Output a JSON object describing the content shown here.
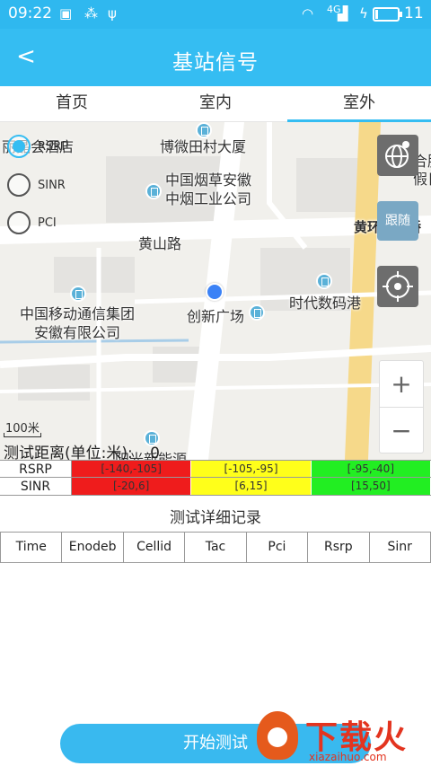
{
  "status_bar": {
    "time": "09:22",
    "network": "4G",
    "battery": "11",
    "battery_level": 0.11
  },
  "title_bar": {
    "back": "<",
    "title": "基站信号"
  },
  "tabs": [
    {
      "label": "首页"
    },
    {
      "label": "室内"
    },
    {
      "label": "室外"
    }
  ],
  "map": {
    "labels": {
      "hotel": "丽晶会酒店",
      "building1": "博微田村大厦",
      "tobacco": "中国烟草安徽\n中烟工业公司",
      "road": "黄山路",
      "china_mobile": "中国移动通信集团\n安徽有限公司",
      "plaza": "创新广场",
      "digital": "时代数码港",
      "edge_right1": "合肥\n假日",
      "bridge": "黄环立交桥",
      "energy": "阳光新能源"
    },
    "radio_options": [
      {
        "label": "RSRP",
        "selected": true
      },
      {
        "label": "SINR",
        "selected": false
      },
      {
        "label": "PCI",
        "selected": false
      }
    ],
    "follow_label": "跟随",
    "zoom_in": "+",
    "zoom_out": "−",
    "scale_label": "100米",
    "distance_label": "测试距离(单位:米):",
    "distance_value": "0"
  },
  "legend": [
    {
      "name": "RSRP",
      "ranges": [
        "[-140,-105]",
        "[-105,-95]",
        "[-95,-40]"
      ]
    },
    {
      "name": "SINR",
      "ranges": [
        "[-20,6]",
        "[6,15]",
        "[15,50]"
      ]
    }
  ],
  "colors": {
    "bad": "#ef1c1c",
    "medium": "#ffff1a",
    "good": "#22ee22",
    "accent": "#35bdf2"
  },
  "records": {
    "title": "测试详细记录",
    "columns": [
      "Time",
      "Enodeb",
      "Cellid",
      "Tac",
      "Pci",
      "Rsrp",
      "Sinr"
    ]
  },
  "start_button": "开始测试",
  "watermark": {
    "text": "下载火",
    "url": "xiazaihuo.com"
  }
}
